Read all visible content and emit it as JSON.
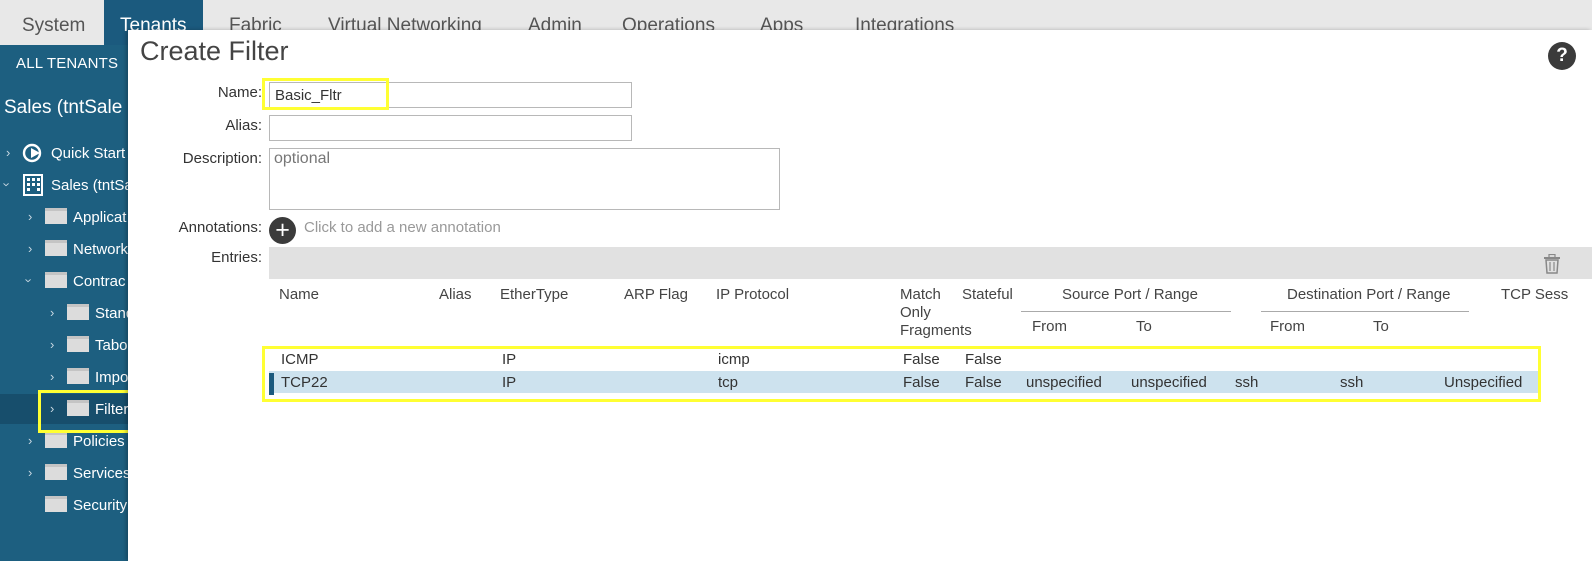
{
  "nav": {
    "tabs": [
      {
        "label": "System"
      },
      {
        "label": "Tenants"
      },
      {
        "label": "Fabric"
      },
      {
        "label": "Virtual Networking"
      },
      {
        "label": "Admin"
      },
      {
        "label": "Operations"
      },
      {
        "label": "Apps"
      },
      {
        "label": "Integrations"
      }
    ],
    "active_tab": "Tenants"
  },
  "sidebar": {
    "all_tenants": "ALL TENANTS",
    "tenant_title": "Sales (tntSale",
    "items": [
      {
        "label": "Quick Start"
      },
      {
        "label": "Sales (tntSa"
      },
      {
        "label": "Applicat"
      },
      {
        "label": "Network"
      },
      {
        "label": "Contrac"
      },
      {
        "label": "Stand"
      },
      {
        "label": "Tabo"
      },
      {
        "label": "Impo"
      },
      {
        "label": "Filter"
      },
      {
        "label": "Policies"
      },
      {
        "label": "Services"
      },
      {
        "label": "Security"
      }
    ]
  },
  "dialog": {
    "title": "Create Filter",
    "help": "?",
    "name_label": "Name:",
    "name_value": "Basic_Fltr",
    "alias_label": "Alias:",
    "alias_value": "",
    "description_label": "Description:",
    "description_placeholder": "optional",
    "annotations_label": "Annotations:",
    "annotations_hint": "Click to add a new annotation",
    "entries_label": "Entries:"
  },
  "table": {
    "headers": {
      "name": "Name",
      "alias": "Alias",
      "ethertype": "EtherType",
      "arp_flag": "ARP Flag",
      "ip_protocol": "IP Protocol",
      "match_only_fragments": [
        "Match",
        "Only",
        "Fragments"
      ],
      "stateful": "Stateful",
      "source_port_range": "Source Port / Range",
      "destination_port_range": "Destination Port / Range",
      "tcp_session": "TCP Sess",
      "from": "From",
      "to": "To"
    },
    "rows": [
      {
        "name": "ICMP",
        "alias": "",
        "ethertype": "IP",
        "arp_flag": "",
        "ip_protocol": "icmp",
        "match_only_fragments": "False",
        "stateful": "False",
        "src_from": "",
        "src_to": "",
        "dst_from": "",
        "dst_to": "",
        "tcp_session": ""
      },
      {
        "name": "TCP22",
        "alias": "",
        "ethertype": "IP",
        "arp_flag": "",
        "ip_protocol": "tcp",
        "match_only_fragments": "False",
        "stateful": "False",
        "src_from": "unspecified",
        "src_to": "unspecified",
        "dst_from": "ssh",
        "dst_to": "ssh",
        "tcp_session": "Unspecified"
      }
    ]
  }
}
